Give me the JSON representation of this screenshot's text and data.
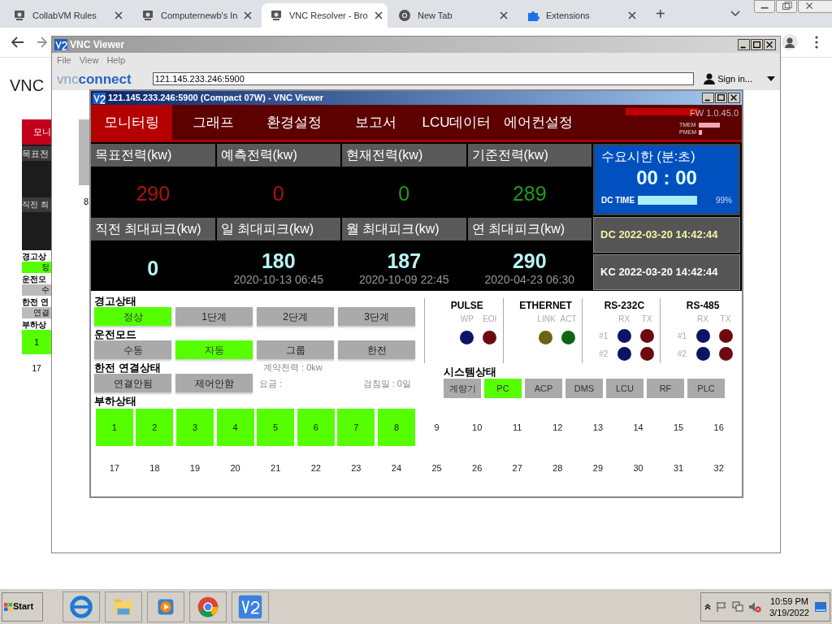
{
  "browser": {
    "tabs": [
      {
        "label": "CollabVM Rules",
        "selected": false
      },
      {
        "label": "Computernewb's In",
        "selected": false
      },
      {
        "label": "VNC Resolver - Bro",
        "selected": true
      },
      {
        "label": "New Tab",
        "selected": false
      },
      {
        "label": "Extensions",
        "selected": false
      }
    ],
    "new_tab": "+"
  },
  "page": {
    "heading": "VNC",
    "background_app": {
      "nav": "모니",
      "labels": [
        "목표전",
        "직전 최"
      ],
      "sections": [
        "경고상",
        "운전모",
        "한전 연",
        "부하상"
      ],
      "buttons": [
        "정",
        "수",
        "연결"
      ],
      "loads": [
        "1",
        "17"
      ]
    },
    "thumbnail_number": "8"
  },
  "vnc_viewer": {
    "title": "VNC Viewer",
    "menu": [
      "File",
      "View",
      "Help"
    ],
    "logo": [
      "vnc",
      "connect"
    ],
    "address": "121.145.233.246:5900",
    "sign_in": "Sign in..."
  },
  "session": {
    "title": "121.145.233.246:5900 (Compact 07W) - VNC Viewer",
    "nav": [
      {
        "label": "모니터링",
        "selected": true
      },
      {
        "label": "그래프",
        "selected": false
      },
      {
        "label": "환경설정",
        "selected": false
      },
      {
        "label": "보고서",
        "selected": false
      },
      {
        "label": "LCU데이터",
        "selected": false
      },
      {
        "label": "에어컨설정",
        "selected": false
      }
    ],
    "firmware": "FW 1.0.45.0",
    "memory": [
      {
        "label": "TMEM"
      },
      {
        "label": "PMEM"
      }
    ],
    "power": [
      {
        "label": "목표전력(kw)",
        "value": "290",
        "color": "#b01010"
      },
      {
        "label": "예측전력(kw)",
        "value": "0",
        "color": "#b01010"
      },
      {
        "label": "현재전력(kw)",
        "value": "0",
        "color": "#1f9a1f"
      },
      {
        "label": "기준전력(kw)",
        "value": "289",
        "color": "#1f9a1f"
      },
      {
        "label": "직전 최대피크(kw)",
        "value": "0",
        "color": "#b8f4f4"
      },
      {
        "label": "일 최대피크(kw)",
        "value": "180",
        "date": "2020-10-13 06:45",
        "color": "#b8f4f4"
      },
      {
        "label": "월 최대피크(kw)",
        "value": "187",
        "date": "2020-10-09 22:45",
        "color": "#b8f4f4"
      },
      {
        "label": "연 최대피크(kw)",
        "value": "290",
        "date": "2020-04-23 06:30",
        "color": "#b8f4f4"
      }
    ],
    "demand": {
      "title": "수요시한 (분:초)",
      "time": "00 : 00",
      "bar_label": "DC TIME",
      "percent": "99%"
    },
    "clocks": [
      {
        "text": "DC 2022-03-20 14:42:44",
        "color": "#f4f4a8"
      },
      {
        "text": "KC 2022-03-20 14:42:44",
        "color": "#ffffff"
      }
    ],
    "alarm": {
      "title": "경고상태",
      "options": [
        {
          "label": "정상",
          "selected": true
        },
        {
          "label": "1단계",
          "selected": false
        },
        {
          "label": "2단계",
          "selected": false
        },
        {
          "label": "3단계",
          "selected": false
        }
      ]
    },
    "mode": {
      "title": "운전모드",
      "options": [
        {
          "label": "수동",
          "selected": false
        },
        {
          "label": "자동",
          "selected": true
        },
        {
          "label": "그룹",
          "selected": false
        },
        {
          "label": "한전",
          "selected": false
        }
      ]
    },
    "connection": {
      "title": "한전 연결상태",
      "options": [
        {
          "label": "연결안됨",
          "selected": false
        },
        {
          "label": "제어안함",
          "selected": false
        }
      ],
      "contract": "계약전력 : 0kw",
      "fee": "요금 :",
      "meter_day": "검침일 : 0일"
    },
    "indicators": [
      {
        "title": "PULSE",
        "columns": [
          "WP",
          "EOI"
        ],
        "rows": [
          {
            "leds": [
              {
                "color": "#0b1466"
              },
              {
                "color": "#6b0b10"
              }
            ]
          }
        ]
      },
      {
        "title": "ETHERNET",
        "columns": [
          "LINK",
          "ACT"
        ],
        "rows": [
          {
            "leds": [
              {
                "color": "#6b6410"
              },
              {
                "color": "#0d6612"
              }
            ]
          }
        ]
      },
      {
        "title": "RS-232C",
        "columns": [
          "RX",
          "TX"
        ],
        "rows": [
          {
            "label": "#1",
            "leds": [
              {
                "color": "#0b1466"
              },
              {
                "color": "#6b0b10"
              }
            ]
          },
          {
            "label": "#2",
            "leds": [
              {
                "color": "#0b1466"
              },
              {
                "color": "#6b0b10"
              }
            ]
          }
        ]
      },
      {
        "title": "RS-485",
        "columns": [
          "RX",
          "TX"
        ],
        "rows": [
          {
            "label": "#1",
            "leds": [
              {
                "color": "#0b1466"
              },
              {
                "color": "#6b0b10"
              }
            ]
          },
          {
            "label": "#2",
            "leds": [
              {
                "color": "#0b1466"
              },
              {
                "color": "#6b0b10"
              }
            ]
          }
        ]
      }
    ],
    "system": {
      "title": "시스템상태",
      "items": [
        {
          "label": "계량기",
          "on": false
        },
        {
          "label": "PC",
          "on": true
        },
        {
          "label": "ACP",
          "on": false
        },
        {
          "label": "DMS",
          "on": false
        },
        {
          "label": "LCU",
          "on": false
        },
        {
          "label": "RF",
          "on": false
        },
        {
          "label": "PLC",
          "on": false
        }
      ]
    },
    "load": {
      "title": "부하상태",
      "loads": [
        {
          "label": "1",
          "on": true
        },
        {
          "label": "2",
          "on": true
        },
        {
          "label": "3",
          "on": true
        },
        {
          "label": "4",
          "on": true
        },
        {
          "label": "5",
          "on": true
        },
        {
          "label": "6",
          "on": true
        },
        {
          "label": "7",
          "on": true
        },
        {
          "label": "8",
          "on": true
        },
        {
          "label": "9",
          "on": false
        },
        {
          "label": "10",
          "on": false
        },
        {
          "label": "11",
          "on": false
        },
        {
          "label": "12",
          "on": false
        },
        {
          "label": "13",
          "on": false
        },
        {
          "label": "14",
          "on": false
        },
        {
          "label": "15",
          "on": false
        },
        {
          "label": "16",
          "on": false
        },
        {
          "label": "17",
          "on": false
        },
        {
          "label": "18",
          "on": false
        },
        {
          "label": "19",
          "on": false
        },
        {
          "label": "20",
          "on": false
        },
        {
          "label": "21",
          "on": false
        },
        {
          "label": "22",
          "on": false
        },
        {
          "label": "23",
          "on": false
        },
        {
          "label": "24",
          "on": false
        },
        {
          "label": "25",
          "on": false
        },
        {
          "label": "26",
          "on": false
        },
        {
          "label": "27",
          "on": false
        },
        {
          "label": "28",
          "on": false
        },
        {
          "label": "29",
          "on": false
        },
        {
          "label": "30",
          "on": false
        },
        {
          "label": "31",
          "on": false
        },
        {
          "label": "32",
          "on": false
        }
      ]
    }
  },
  "taskbar": {
    "start": "Start",
    "time": "10:59 PM",
    "date": "3/19/2022"
  }
}
